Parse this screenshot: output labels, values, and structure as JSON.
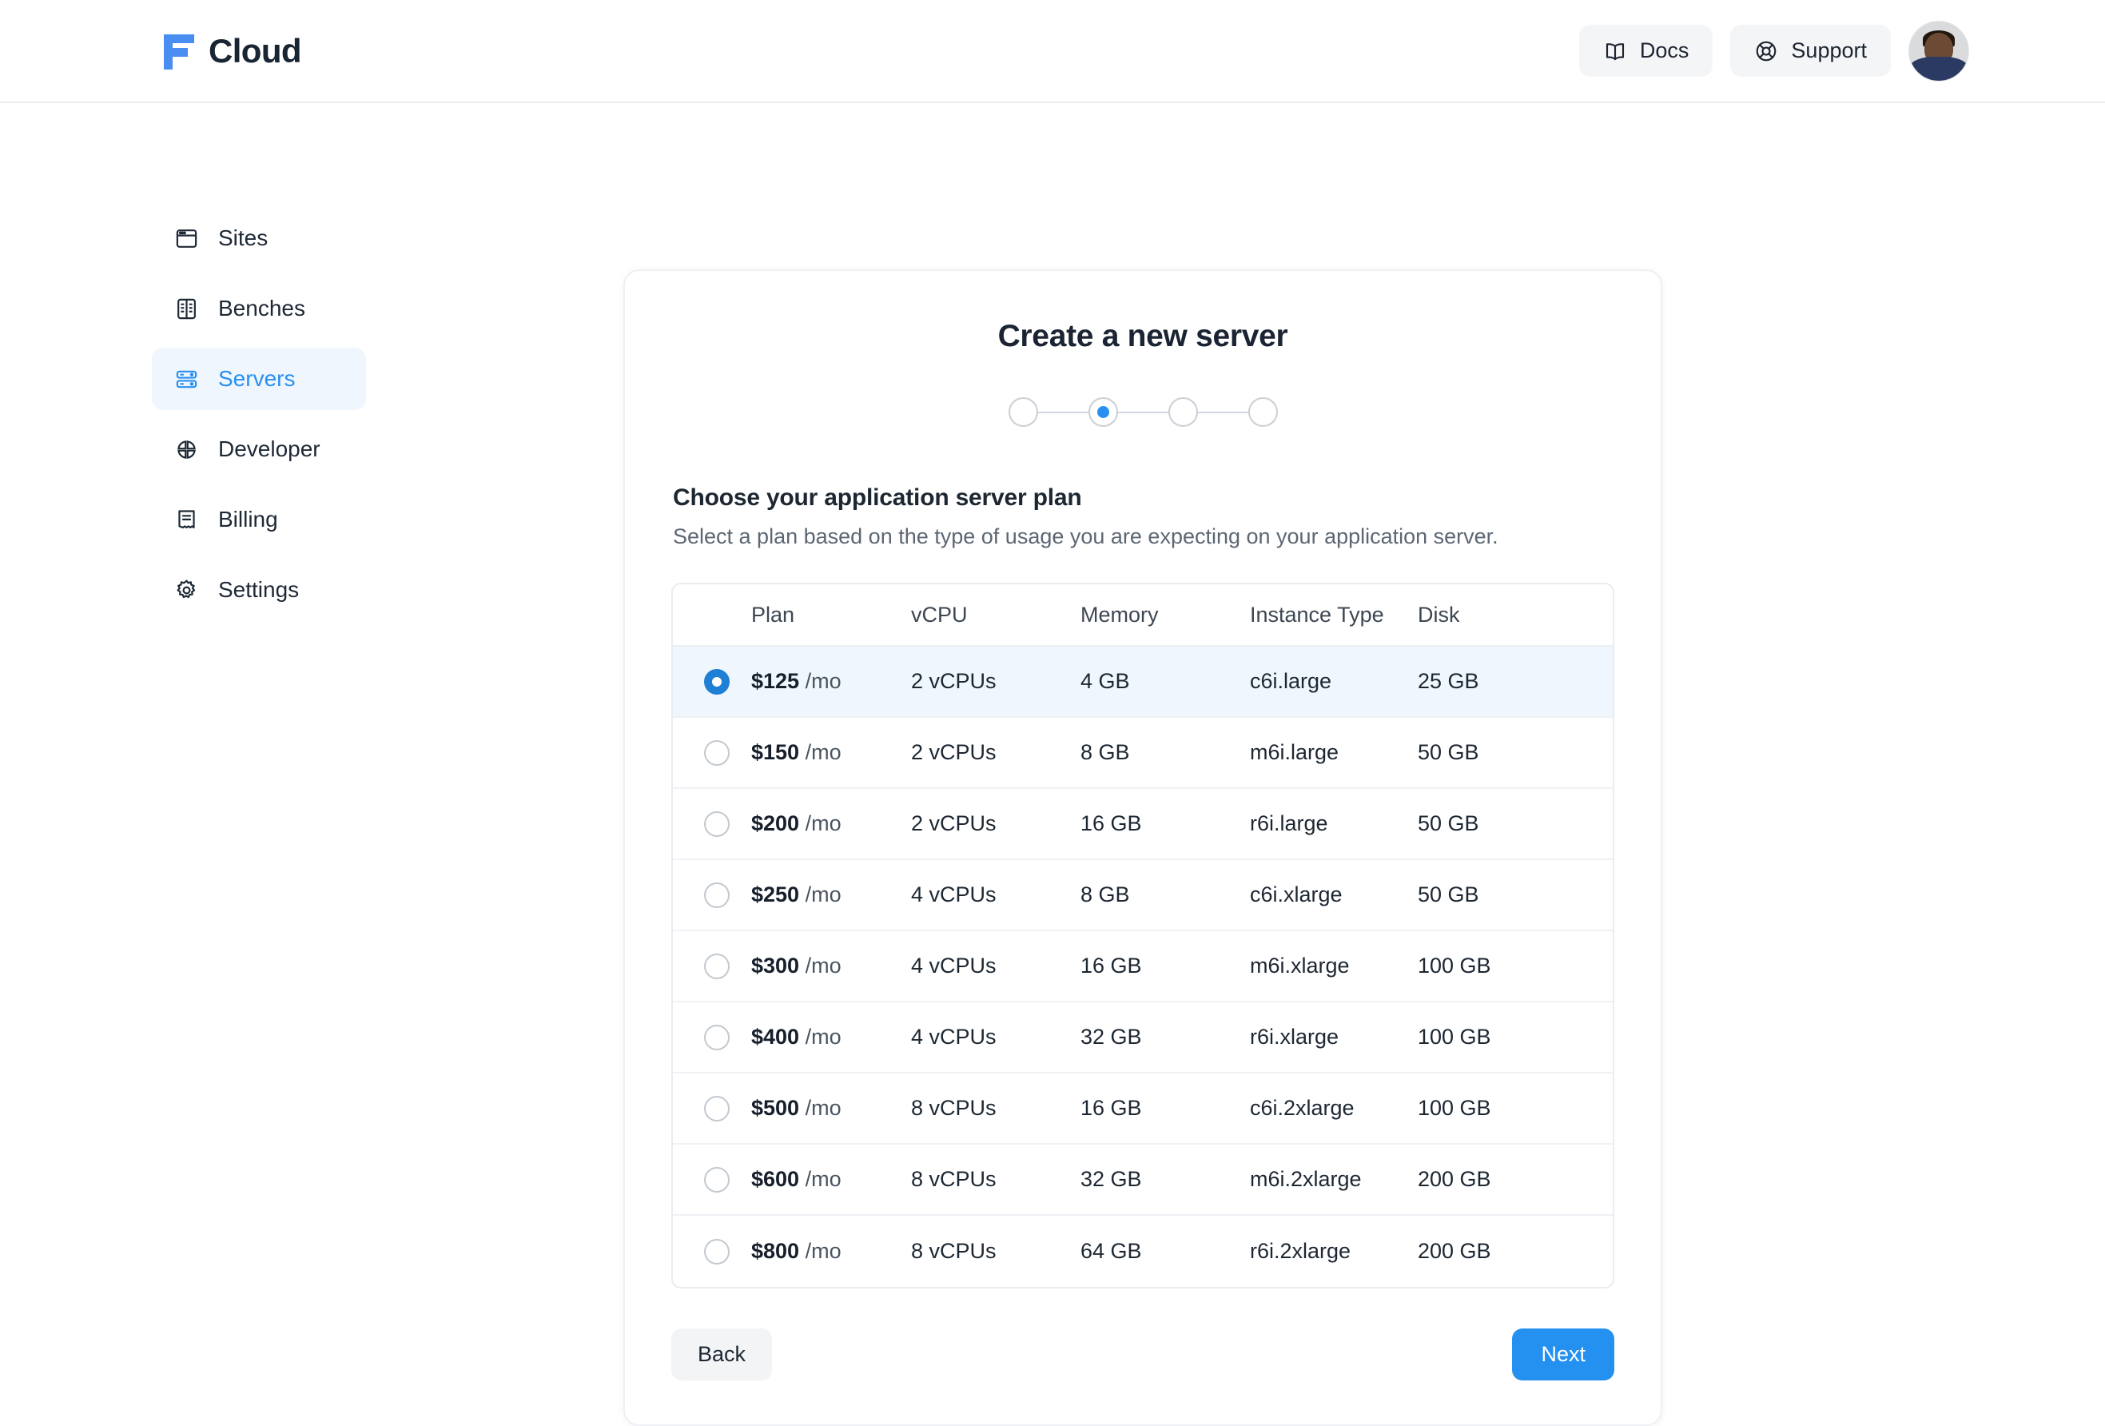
{
  "header": {
    "logo_text": "Cloud",
    "docs_label": "Docs",
    "support_label": "Support"
  },
  "sidebar": {
    "items": [
      {
        "label": "Sites",
        "icon": "browser-window-icon",
        "active": false
      },
      {
        "label": "Benches",
        "icon": "bench-rack-icon",
        "active": false
      },
      {
        "label": "Servers",
        "icon": "server-icon",
        "active": true
      },
      {
        "label": "Developer",
        "icon": "quadrants-icon",
        "active": false
      },
      {
        "label": "Billing",
        "icon": "receipt-icon",
        "active": false
      },
      {
        "label": "Settings",
        "icon": "gear-icon",
        "active": false
      }
    ]
  },
  "card": {
    "title": "Create a new server",
    "stepper": {
      "total_steps": 4,
      "active_step": 2
    },
    "section_title": "Choose your application server plan",
    "section_subtitle": "Select a plan based on the type of usage you are expecting on your application server.",
    "table": {
      "columns": [
        "Plan",
        "vCPU",
        "Memory",
        "Instance Type",
        "Disk"
      ],
      "rows": [
        {
          "price": "$125",
          "per": "/mo",
          "vcpu": "2 vCPUs",
          "memory": "4 GB",
          "instance_type": "c6i.large",
          "disk": "25 GB",
          "selected": true
        },
        {
          "price": "$150",
          "per": "/mo",
          "vcpu": "2 vCPUs",
          "memory": "8 GB",
          "instance_type": "m6i.large",
          "disk": "50 GB",
          "selected": false
        },
        {
          "price": "$200",
          "per": "/mo",
          "vcpu": "2 vCPUs",
          "memory": "16 GB",
          "instance_type": "r6i.large",
          "disk": "50 GB",
          "selected": false
        },
        {
          "price": "$250",
          "per": "/mo",
          "vcpu": "4 vCPUs",
          "memory": "8 GB",
          "instance_type": "c6i.xlarge",
          "disk": "50 GB",
          "selected": false
        },
        {
          "price": "$300",
          "per": "/mo",
          "vcpu": "4 vCPUs",
          "memory": "16 GB",
          "instance_type": "m6i.xlarge",
          "disk": "100 GB",
          "selected": false
        },
        {
          "price": "$400",
          "per": "/mo",
          "vcpu": "4 vCPUs",
          "memory": "32 GB",
          "instance_type": "r6i.xlarge",
          "disk": "100 GB",
          "selected": false
        },
        {
          "price": "$500",
          "per": "/mo",
          "vcpu": "8 vCPUs",
          "memory": "16 GB",
          "instance_type": "c6i.2xlarge",
          "disk": "100 GB",
          "selected": false
        },
        {
          "price": "$600",
          "per": "/mo",
          "vcpu": "8 vCPUs",
          "memory": "32 GB",
          "instance_type": "m6i.2xlarge",
          "disk": "200 GB",
          "selected": false
        },
        {
          "price": "$800",
          "per": "/mo",
          "vcpu": "8 vCPUs",
          "memory": "64 GB",
          "instance_type": "r6i.2xlarge",
          "disk": "200 GB",
          "selected": false
        }
      ]
    },
    "back_label": "Back",
    "next_label": "Next"
  },
  "colors": {
    "accent_blue": "#2490ef",
    "radio_blue": "#1f7fd4",
    "selected_row_bg": "#eff6fd",
    "sidebar_active_bg": "#eff6fe",
    "text_dark": "#1d2732",
    "logo_blue": "#4a8df0"
  }
}
